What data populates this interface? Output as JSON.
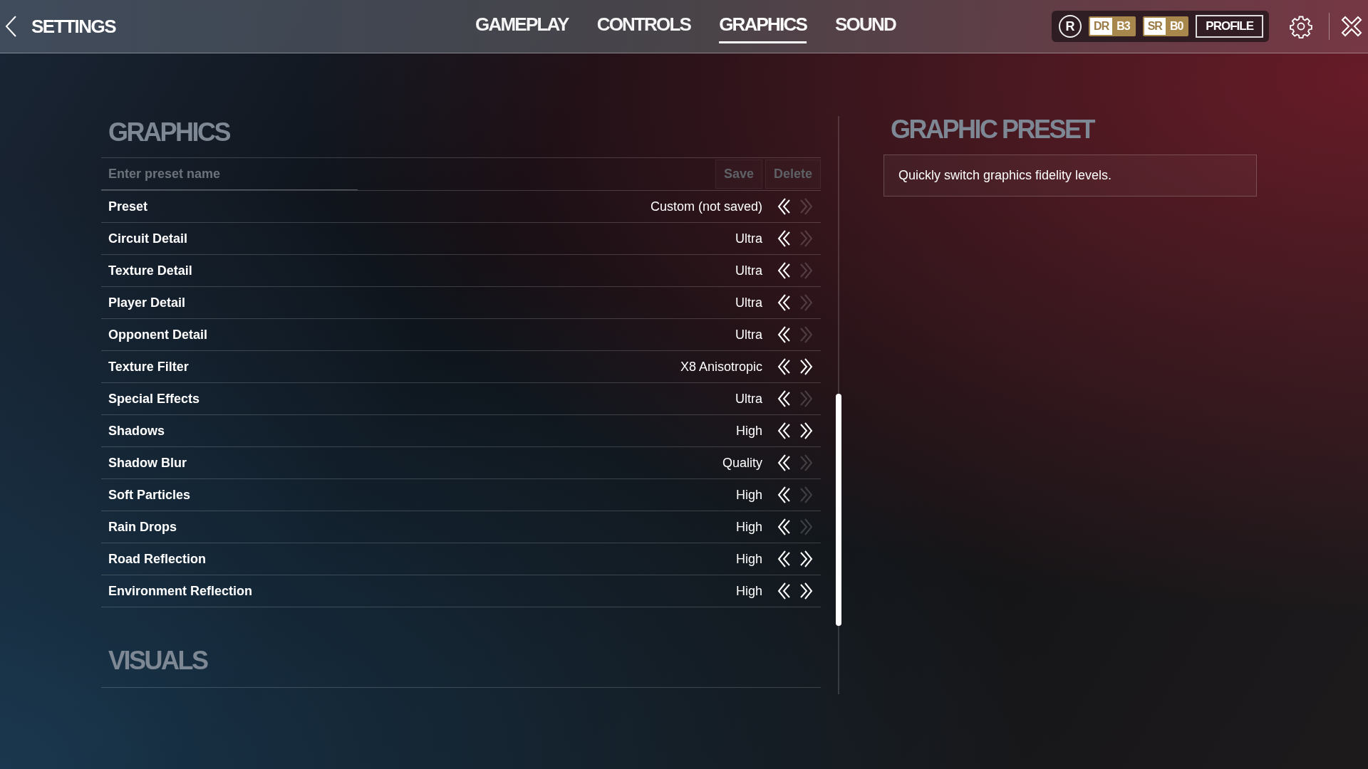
{
  "header": {
    "back_label": "SETTINGS",
    "tabs": [
      {
        "label": "GAMEPLAY",
        "selected": false
      },
      {
        "label": "CONTROLS",
        "selected": false
      },
      {
        "label": "GRAPHICS",
        "selected": true
      },
      {
        "label": "SOUND",
        "selected": false
      }
    ],
    "rank": "R",
    "ratings": [
      {
        "label": "DR",
        "value": "B3"
      },
      {
        "label": "SR",
        "value": "B0"
      }
    ],
    "profile": "PROFILE"
  },
  "graphics": {
    "title": "GRAPHICS",
    "preset_field": {
      "placeholder": "Enter preset name"
    },
    "buttons": [
      {
        "label": "Save",
        "disabled": true
      },
      {
        "label": "Delete",
        "disabled": true
      }
    ],
    "rows": [
      {
        "label": "Preset",
        "value": "Custom (not saved)",
        "prev_enabled": true,
        "next_enabled": false
      },
      {
        "label": "Circuit Detail",
        "value": "Ultra",
        "prev_enabled": true,
        "next_enabled": false
      },
      {
        "label": "Texture Detail",
        "value": "Ultra",
        "prev_enabled": true,
        "next_enabled": false
      },
      {
        "label": "Player Detail",
        "value": "Ultra",
        "prev_enabled": true,
        "next_enabled": false
      },
      {
        "label": "Opponent Detail",
        "value": "Ultra",
        "prev_enabled": true,
        "next_enabled": false
      },
      {
        "label": "Texture Filter",
        "value": "X8 Anisotropic",
        "prev_enabled": true,
        "next_enabled": true
      },
      {
        "label": "Special Effects",
        "value": "Ultra",
        "prev_enabled": true,
        "next_enabled": false
      },
      {
        "label": "Shadows",
        "value": "High",
        "prev_enabled": true,
        "next_enabled": true
      },
      {
        "label": "Shadow Blur",
        "value": "Quality",
        "prev_enabled": true,
        "next_enabled": false
      },
      {
        "label": "Soft Particles",
        "value": "High",
        "prev_enabled": true,
        "next_enabled": false
      },
      {
        "label": "Rain Drops",
        "value": "High",
        "prev_enabled": true,
        "next_enabled": false
      },
      {
        "label": "Road Reflection",
        "value": "High",
        "prev_enabled": true,
        "next_enabled": true
      },
      {
        "label": "Environment Reflection",
        "value": "High",
        "prev_enabled": true,
        "next_enabled": true
      }
    ]
  },
  "visuals": {
    "title": "VISUALS"
  },
  "info_panel": {
    "title": "GRAPHIC PRESET",
    "description": "Quickly switch graphics fidelity levels."
  }
}
